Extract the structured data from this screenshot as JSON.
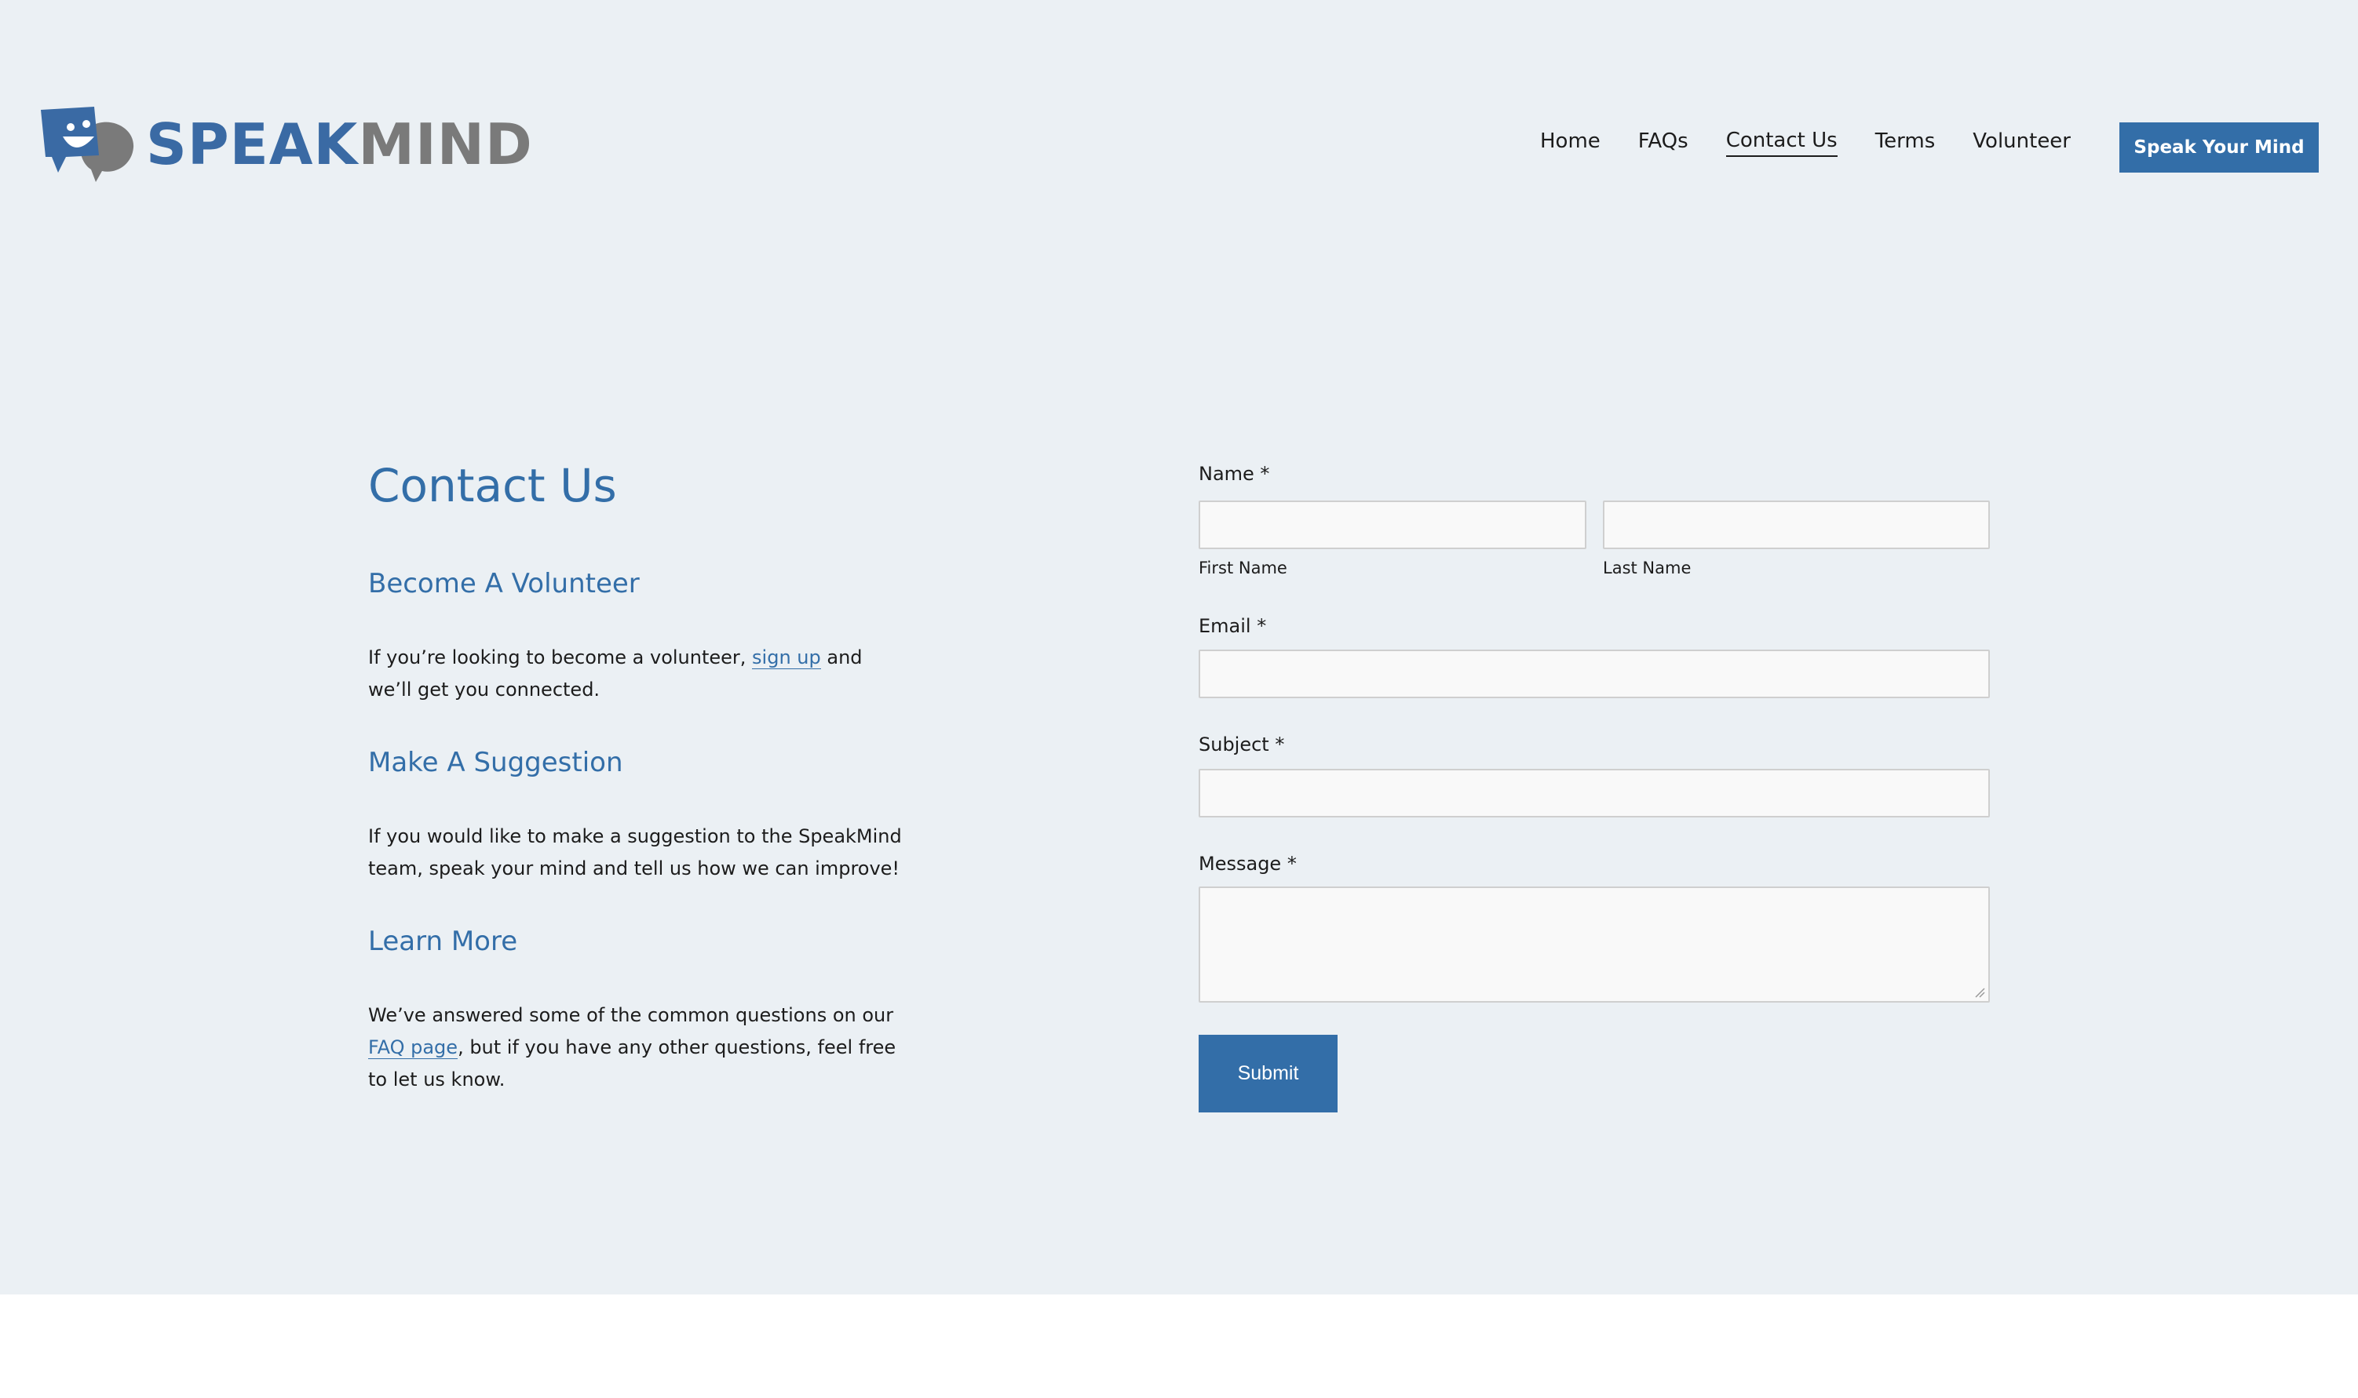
{
  "brand": {
    "name_part1": "SPEAK",
    "name_part2": "MIND",
    "primary_color": "#336ea8",
    "secondary_color": "#7a7a7a",
    "logo_icon": "speech-bubble-face-icon"
  },
  "nav": {
    "items": [
      {
        "label": "Home"
      },
      {
        "label": "FAQs"
      },
      {
        "label": "Contact Us",
        "active": true
      },
      {
        "label": "Terms"
      },
      {
        "label": "Volunteer"
      }
    ],
    "cta_label": "Speak Your Mind"
  },
  "content": {
    "title": "Contact Us",
    "sections": [
      {
        "heading": "Become A Volunteer",
        "text_before": "If you’re looking to become a volunteer, ",
        "link": "sign up",
        "text_after": " and we’ll  get you connected."
      },
      {
        "heading": "Make A Suggestion",
        "text": "If you would like to make a suggestion to the SpeakMind team, speak your mind and tell us how we can improve!"
      },
      {
        "heading": "Learn More",
        "text_before": "We’ve answered some of the common questions on our ",
        "link": "FAQ page",
        "text_after": ", but if you have any other questions, feel free to let us know."
      }
    ]
  },
  "form": {
    "name_label": "Name *",
    "first_name_label": "First Name",
    "last_name_label": "Last Name",
    "email_label": "Email *",
    "subject_label": "Subject *",
    "message_label": "Message *",
    "first_name_value": "",
    "last_name_value": "",
    "email_value": "",
    "subject_value": "",
    "message_value": "",
    "submit_label": "Submit"
  }
}
